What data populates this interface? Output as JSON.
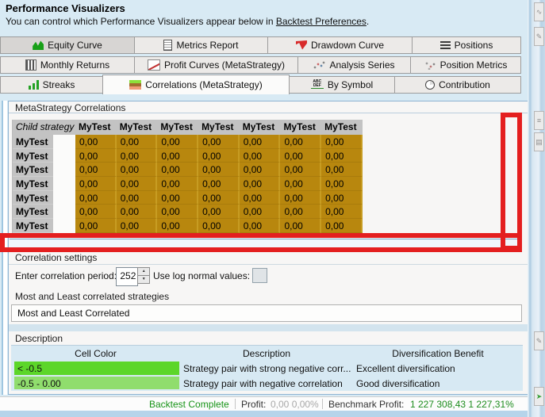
{
  "header": {
    "title": "Performance Visualizers",
    "subtitle_prefix": "You can control which Performance Visualizers appear below in ",
    "subtitle_link": "Backtest Preferences",
    "subtitle_suffix": "."
  },
  "tabs": {
    "rows": [
      [
        {
          "label": "Equity Curve",
          "icon": "equity-curve",
          "pressed": true
        },
        {
          "label": "Metrics Report",
          "icon": "metrics-report"
        },
        {
          "label": "Drawdown Curve",
          "icon": "drawdown-curve"
        },
        {
          "label": "Positions",
          "icon": "positions"
        }
      ],
      [
        {
          "label": "Monthly Returns",
          "icon": "monthly-returns"
        },
        {
          "label": "Profit Curves (MetaStrategy)",
          "icon": "profit-curves"
        },
        {
          "label": "Analysis Series",
          "icon": "analysis-series"
        },
        {
          "label": "Position Metrics",
          "icon": "position-metrics"
        }
      ],
      [
        {
          "label": "Streaks",
          "icon": "streaks"
        },
        {
          "label": "Correlations (MetaStrategy)",
          "icon": "correlations",
          "active": true
        },
        {
          "label": "By Symbol",
          "icon": "by-symbol"
        },
        {
          "label": "Contribution",
          "icon": "contribution"
        }
      ]
    ]
  },
  "correlations": {
    "section_title": "MetaStrategy Correlations",
    "table": {
      "corner_header": "Child strategy",
      "col_headers": [
        "MyTest",
        "MyTest",
        "MyTest",
        "MyTest",
        "MyTest",
        "MyTest",
        "MyTest"
      ],
      "row_labels": [
        "MyTest",
        "MyTest",
        "MyTest",
        "MyTest",
        "MyTest",
        "MyTest",
        "MyTest"
      ],
      "cell_value": "0,00",
      "cell_color": "#b8870e"
    }
  },
  "settings": {
    "section_title": "Correlation settings",
    "period_label": "Enter correlation period:",
    "period_value": "252",
    "log_label": "Use log normal values:",
    "log_checked": false
  },
  "most_least": {
    "section_title": "Most and Least correlated strategies",
    "box_text": "Most and Least Correlated"
  },
  "description": {
    "section_title": "Description",
    "headers": [
      "Cell Color",
      "Description",
      "Diversification Benefit"
    ],
    "rows": [
      {
        "range": "< -0.5",
        "color": "#5cd629",
        "description": "Strategy pair with strong negative corr...",
        "benefit": "Excellent diversification"
      },
      {
        "range": "-0.5 - 0.00",
        "color": "#90dd6d",
        "description": "Strategy pair with negative correlation",
        "benefit": "Good diversification"
      }
    ]
  },
  "status_bar": {
    "status": "Backtest Complete",
    "profit_label": "Profit:",
    "profit_value": "0,00 0,00%",
    "benchmark_label": "Benchmark Profit:",
    "benchmark_value": "1 227 308,43 1 227,31%"
  },
  "annotations": {
    "highlight_color": "#e41f1f"
  },
  "right_toolbar": {
    "icons": [
      {
        "name": "curve-tool-icon"
      },
      {
        "name": "pen-tool-icon"
      },
      {
        "name": "list-tool-icon"
      },
      {
        "name": "grid-tool-icon"
      },
      {
        "name": "brush-tool-icon"
      },
      {
        "name": "arrow-tool-icon"
      }
    ]
  }
}
